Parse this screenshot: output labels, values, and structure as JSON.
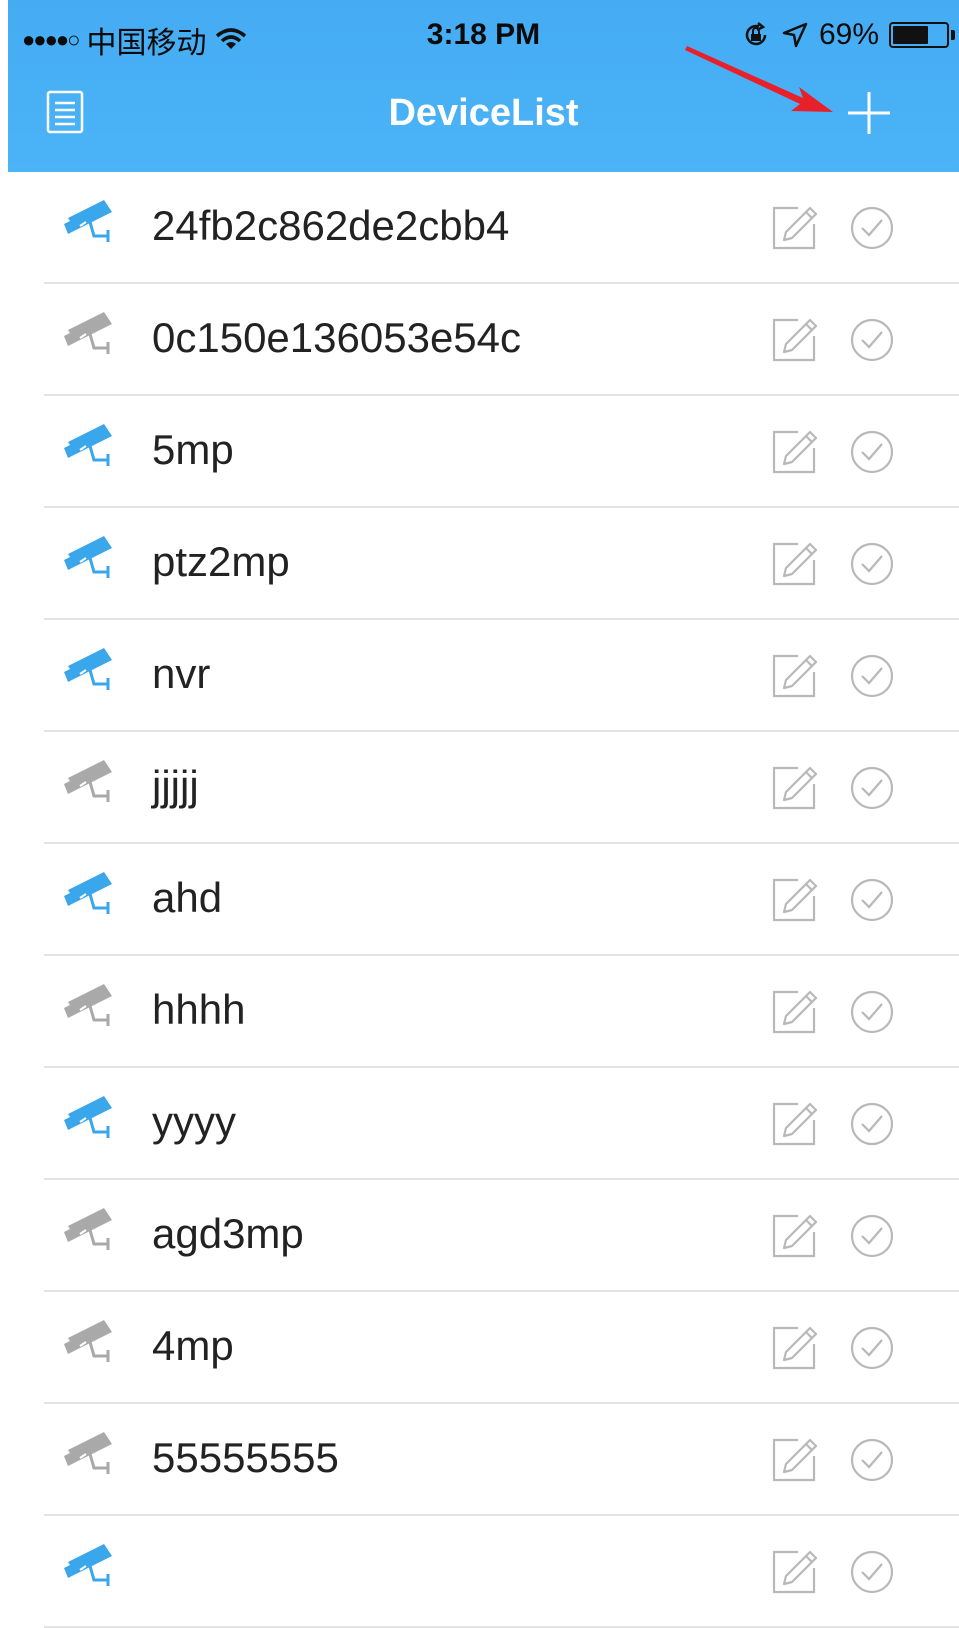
{
  "status_bar": {
    "signal": "●●●●○",
    "carrier": "中国移动",
    "time": "3:18 PM",
    "battery_text": "69%",
    "battery_level": 0.69
  },
  "nav": {
    "title": "DeviceList",
    "menu_icon": "list-menu-icon",
    "add_icon": "plus-icon"
  },
  "colors": {
    "header": "#47aff5",
    "online": "#3aa6ec",
    "offline": "#a9a9a9",
    "annotation_arrow": "#e8202a"
  },
  "devices": [
    {
      "name": "24fb2c862de2cbb4",
      "online": true
    },
    {
      "name": "0c150e136053e54c",
      "online": false
    },
    {
      "name": "5mp",
      "online": true
    },
    {
      "name": "ptz2mp",
      "online": true
    },
    {
      "name": "nvr",
      "online": true
    },
    {
      "name": "jjjjj",
      "online": false
    },
    {
      "name": "ahd",
      "online": true
    },
    {
      "name": "hhhh",
      "online": false
    },
    {
      "name": "yyyy",
      "online": true
    },
    {
      "name": "agd3mp",
      "online": false
    },
    {
      "name": "4mp",
      "online": false
    },
    {
      "name": "55555555",
      "online": false
    },
    {
      "name": "",
      "online": true
    }
  ]
}
